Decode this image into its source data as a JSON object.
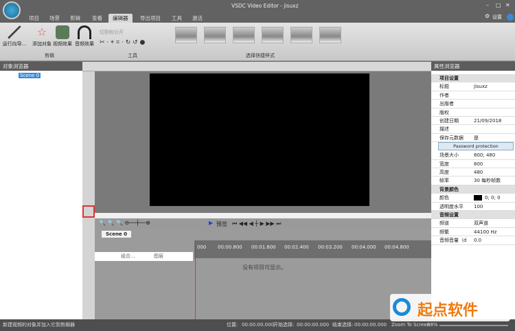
{
  "app": {
    "title": "VSDC Video Editor - jisuxz",
    "settings": "设置"
  },
  "tabs": [
    "项目",
    "场景",
    "剪辑",
    "查看",
    "编辑器",
    "导出项目",
    "工具",
    "激活"
  ],
  "ribbon": {
    "wizard": "运行向导...",
    "add_object": "添加对象",
    "video_effects": "视频效果",
    "audio_effects": "音频效果",
    "cut_split": "切割和分开",
    "group_edit": "剪辑",
    "group_tools": "工具",
    "group_styles": "选择快捷样式"
  },
  "left_panel": {
    "title": "对象浏览器",
    "item": "Scene 0"
  },
  "right_panel": {
    "title": "属性浏览器",
    "button": "Password protection",
    "rows": [
      {
        "k": "项目设置",
        "v": "",
        "sec": true
      },
      {
        "k": "标题",
        "v": "jisuxz"
      },
      {
        "k": "作者",
        "v": ""
      },
      {
        "k": "出版者",
        "v": ""
      },
      {
        "k": "版权",
        "v": ""
      },
      {
        "k": "创建日期",
        "v": "21/09/2018"
      },
      {
        "k": "描述",
        "v": ""
      },
      {
        "k": "保存元数据",
        "v": "是"
      }
    ],
    "rows2": [
      {
        "k": "场景大小",
        "v": "800; 480"
      },
      {
        "k": "宽度",
        "v": "800"
      },
      {
        "k": "高度",
        "v": "480"
      },
      {
        "k": "帧率",
        "v": "30 每秒帧数"
      },
      {
        "k": "背景颜色",
        "v": "",
        "sec": true
      },
      {
        "k": "颜色",
        "v": "0; 0; 0"
      },
      {
        "k": "透明度水平",
        "v": "100"
      },
      {
        "k": "音频设置",
        "v": "",
        "sec": true
      },
      {
        "k": "频道",
        "v": "双声道"
      },
      {
        "k": "频繁",
        "v": "44100 Hz"
      },
      {
        "k": "音频音量（d",
        "v": "0.0"
      }
    ]
  },
  "timeline": {
    "preview": "预览",
    "scene_tab": "Scene 0",
    "ticks": [
      "000",
      "00:00.800",
      "00:01.600",
      "00:02.400",
      "00:03.200",
      "00:04.000",
      "00:04.800"
    ],
    "headers": [
      "组合...",
      "图层"
    ],
    "empty": "没有项目可显示。"
  },
  "status": {
    "message": "新建视频的对象并加入它到剪辑器",
    "pos_label": "位置:",
    "pos": "00:00:00.000",
    "start_label": "开始选择:",
    "start": "00:00:00.000",
    "end_label": "结束选择:",
    "end": "00:00:00.000",
    "zoom_label": "Zoom To Screen",
    "zoom": "68%"
  },
  "watermark": "起点软件"
}
